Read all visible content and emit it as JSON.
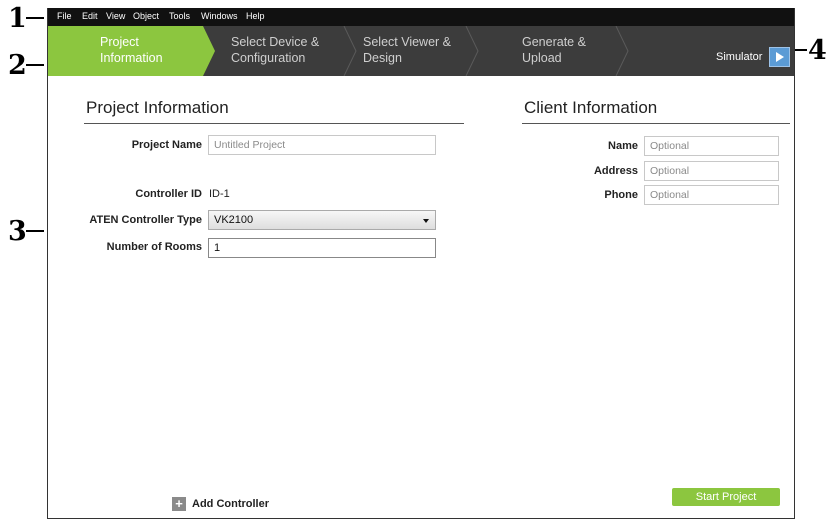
{
  "callouts": [
    "1",
    "2",
    "3",
    "4"
  ],
  "menu": [
    "File",
    "Edit",
    "View",
    "Object",
    "Tools",
    "Windows",
    "Help"
  ],
  "wizard": {
    "steps": [
      {
        "line1": "Project",
        "line2": "Information",
        "active": true
      },
      {
        "line1": "Select Device &",
        "line2": "Configuration",
        "active": false
      },
      {
        "line1": "Select Viewer &",
        "line2": "Design",
        "active": false
      },
      {
        "line1": "Generate &",
        "line2": "Upload",
        "active": false
      }
    ],
    "simulator_label": "Simulator",
    "simulator_icon": "play-icon"
  },
  "project": {
    "title": "Project Information",
    "name_label": "Project Name",
    "name_placeholder": "Untitled Project",
    "controller_id_label": "Controller ID",
    "controller_id_value": "ID-1",
    "controller_type_label": "ATEN Controller Type",
    "controller_type_value": "VK2100",
    "rooms_label": "Number of Rooms",
    "rooms_value": "1"
  },
  "client": {
    "title": "Client Information",
    "name_label": "Name",
    "name_placeholder": "Optional",
    "address_label": "Address",
    "address_placeholder": "Optional",
    "phone_label": "Phone",
    "phone_placeholder": "Optional"
  },
  "footer": {
    "add_icon": "+",
    "add_controller_label": "Add Controller",
    "start_project_label": "Start Project"
  },
  "colors": {
    "accent_green": "#8cc63f",
    "wizard_bg": "#3c3c3c",
    "menubar_bg": "#111111",
    "simulator_blue": "#5b9bd5"
  }
}
